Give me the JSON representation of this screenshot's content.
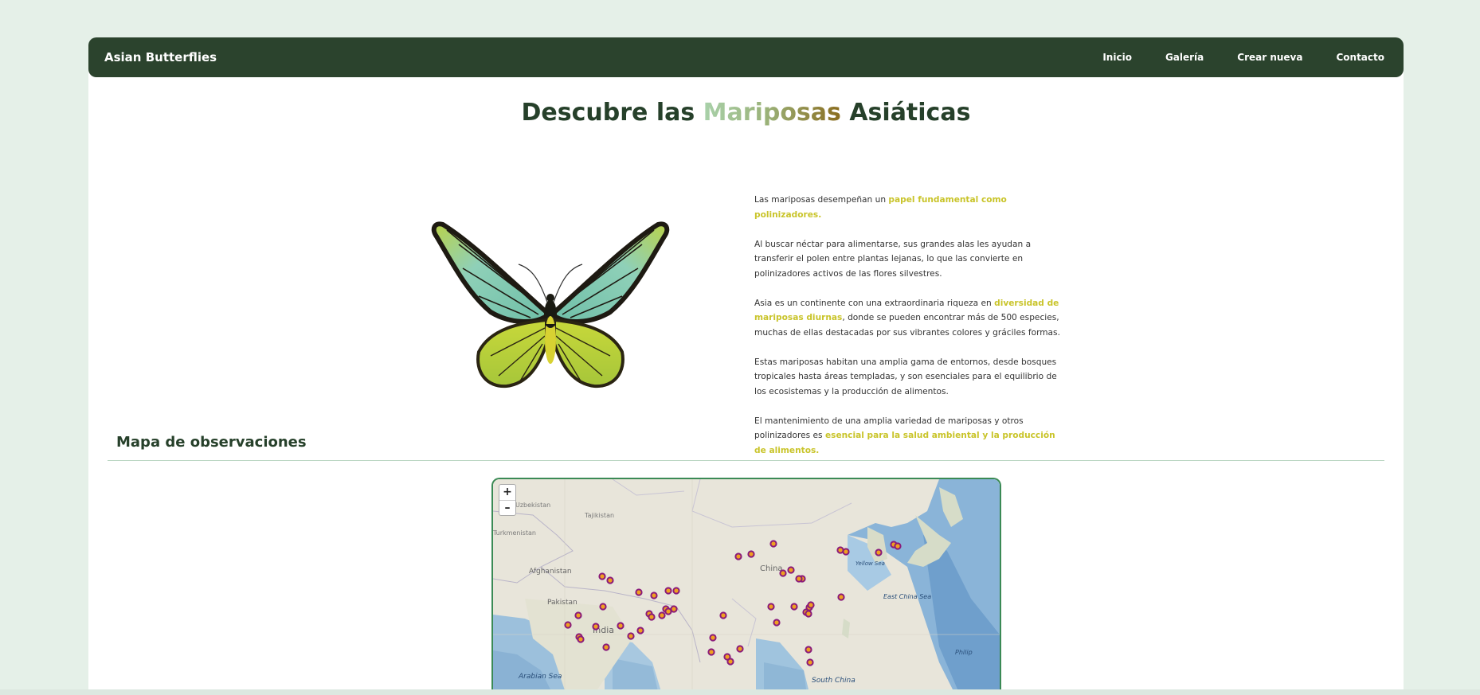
{
  "navbar": {
    "brand": "Asian Butterflies",
    "links": [
      {
        "label": "Inicio"
      },
      {
        "label": "Galería"
      },
      {
        "label": "Crear nueva"
      },
      {
        "label": "Contacto"
      }
    ]
  },
  "hero": {
    "title_before": "Descubre las ",
    "title_accent": "Mariposas",
    "title_after": " Asiáticas"
  },
  "intro": {
    "p1_text": "Las mariposas desempeñan un ",
    "p1_highlight": "papel fundamental como polinizadores.",
    "p2_text": "Al buscar néctar para alimentarse, sus grandes alas les ayudan a transferir el polen entre plantas lejanas, lo que las convierte en polinizadores activos de las flores silvestres.",
    "p3_text": "Asia es un continente con una extraordinaria riqueza en ",
    "p3_highlight": "diversidad de mariposas diurnas",
    "p3_after": ", donde se pueden encontrar más de 500 especies, muchas de ellas destacadas por sus vibrantes colores y gráciles formas.",
    "p4_text": "Estas mariposas habitan una amplia gama de entornos, desde bosques tropicales hasta áreas templadas, y son esenciales para el equilibrio de los ecosistemas y la producción de alimentos.",
    "p5_text": "El mantenimiento de una amplia variedad de mariposas y otros polinizadores es ",
    "p5_highlight": "esencial para la salud ambiental y la producción de alimentos."
  },
  "map_section": {
    "title": "Mapa de observaciones",
    "zoom_in": "+",
    "zoom_out": "–",
    "labels": {
      "uzbekistan": "Uzbekistan",
      "turkmenistan": "Turkmenistan",
      "tajikistan": "Tajikistan",
      "afghanistan": "Afghanistan",
      "pakistan": "Pakistan",
      "india": "India",
      "china": "China",
      "yellow_sea": "Yellow Sea",
      "east_china_sea": "East China Sea",
      "arabian_sea": "Arabian Sea",
      "south_china": "South China",
      "philippine_sea": "Philip"
    }
  },
  "colors": {
    "nav_bg": "#2b432d",
    "page_bg": "#e5f0e8",
    "highlight": "#c9c42a",
    "marker_ring": "#8a1a7a",
    "marker_fill": "#f0a020"
  }
}
